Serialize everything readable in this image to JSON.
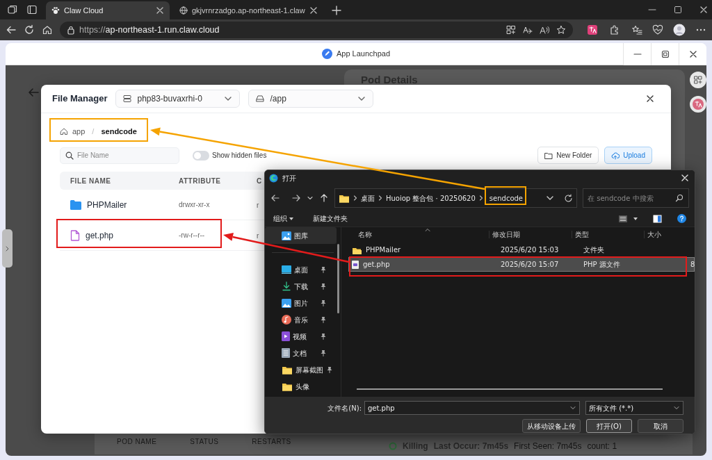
{
  "browser": {
    "tabs": [
      {
        "label": "Claw Cloud",
        "kind": "paw",
        "selected": true
      },
      {
        "label": "gkjvrnrzadgo.ap-northeast-1.claw",
        "kind": "globe",
        "selected": false
      }
    ],
    "url_scheme": "https://",
    "url_host": "ap-northeast-1.run.claw.cloud"
  },
  "app_window": {
    "title": "App Launchpad"
  },
  "background": {
    "card_title": "Pod Details",
    "pod_columns": [
      "POD NAME",
      "STATUS",
      "RESTARTS"
    ],
    "event": {
      "reason": "Killing",
      "last_occur": "Last Occur: 7m45s",
      "first_seen": "First Seen: 7m45s",
      "count": "count: 1"
    }
  },
  "file_manager": {
    "title": "File Manager",
    "pod_select": "php83-buvaxrhi-0",
    "path_select": "/app",
    "breadcrumb": {
      "items": [
        "app",
        "sendcode"
      ],
      "separator": "/"
    },
    "search": {
      "placeholder": "File Name"
    },
    "show_hidden": {
      "label": "Show hidden files",
      "on": false
    },
    "buttons": [
      {
        "label": "New Folder",
        "kind": "outline"
      },
      {
        "label": "Upload",
        "kind": "primary"
      }
    ],
    "columns": [
      "FILE NAME",
      "ATTRIBUTE",
      "C"
    ],
    "rows": [
      {
        "name": "PHPMailer",
        "kind": "folder",
        "attribute": "drwxr-xr-x",
        "column_3": "r"
      },
      {
        "name": "get.php",
        "kind": "file",
        "attribute": "-rw-r--r--",
        "column_3": "r"
      }
    ]
  },
  "open_dialog": {
    "title": "打开",
    "path": [
      "桌面",
      "Huoiop 整合包 · 20250620",
      "sendcode"
    ],
    "search": {
      "placeholder": "在 sendcode 中搜索"
    },
    "toolbar": [
      "组织",
      "新建文件夹"
    ],
    "sidebar": [
      {
        "label": "图库",
        "kind": "gallery",
        "pinned": false,
        "selected": true
      },
      {
        "label": "桌面",
        "kind": "desktop",
        "pinned": true,
        "selected": false
      },
      {
        "label": "下载",
        "kind": "download",
        "pinned": true,
        "selected": false
      },
      {
        "label": "图片",
        "kind": "pictures",
        "pinned": true,
        "selected": false
      },
      {
        "label": "音乐",
        "kind": "music",
        "pinned": true,
        "selected": false
      },
      {
        "label": "视频",
        "kind": "video",
        "pinned": true,
        "selected": false
      },
      {
        "label": "文档",
        "kind": "document",
        "pinned": true,
        "selected": false
      },
      {
        "label": "屏幕截图",
        "kind": "folder",
        "pinned": true,
        "selected": false
      },
      {
        "label": "头像",
        "kind": "folder",
        "pinned": false,
        "selected": false
      }
    ],
    "columns": [
      "名称",
      "修改日期",
      "类型",
      "大小"
    ],
    "rows": [
      {
        "name": "PHPMailer",
        "kind": "folder",
        "modified": "2025/6/20 15:03",
        "type": "文件夹",
        "selected": false
      },
      {
        "name": "get.php",
        "kind": "file",
        "modified": "2025/6/20 15:07",
        "type": "PHP 源文件",
        "size": "8",
        "selected": true
      }
    ],
    "filename_label": "文件名(N):",
    "filename": "get.php",
    "filter": "所有文件 (*.*)",
    "buttons": [
      {
        "label": "从移动设备上传",
        "default": false
      },
      {
        "label": "打开(O)",
        "default": true
      },
      {
        "label": "取消",
        "default": false
      }
    ]
  },
  "annotations": [
    {
      "color": "#f5a300"
    },
    {
      "color": "#e21b1b"
    }
  ]
}
